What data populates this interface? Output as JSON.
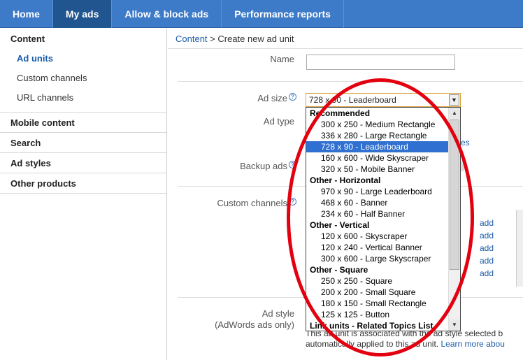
{
  "topnav": {
    "tabs": [
      {
        "label": "Home"
      },
      {
        "label": "My ads"
      },
      {
        "label": "Allow & block ads"
      },
      {
        "label": "Performance reports"
      }
    ]
  },
  "sidebar": {
    "content": "Content",
    "ad_units": "Ad units",
    "custom_channels": "Custom channels",
    "url_channels": "URL channels",
    "mobile_content": "Mobile content",
    "search": "Search",
    "ad_styles": "Ad styles",
    "other_products": "Other products"
  },
  "breadcrumb": {
    "root": "Content",
    "sep": " > ",
    "current": "Create new ad unit"
  },
  "form": {
    "name_label": "Name",
    "name_value": "",
    "ad_size_label": "Ad size",
    "ad_size_value": "728 x 90 - Leaderboard",
    "ad_type_label": "Ad type",
    "backup_ads_label": "Backup ads",
    "custom_channels_label": "Custom channels",
    "ad_style_label": "Ad style",
    "ad_style_sub": "(AdWords ads only)",
    "partial_link": "es",
    "add_links": [
      "add",
      "add",
      "add",
      "add",
      "add"
    ],
    "bottom_line1": "This ad unit is associated with the ad style selected b",
    "bottom_line2": "automatically applied to this ad unit.",
    "learn_more": "Learn more abou"
  },
  "dropdown": {
    "items": [
      {
        "type": "group",
        "label": "Recommended"
      },
      {
        "type": "opt",
        "label": "300 x 250 - Medium Rectangle"
      },
      {
        "type": "opt",
        "label": "336 x 280 - Large Rectangle"
      },
      {
        "type": "opt",
        "label": "728 x 90 - Leaderboard",
        "selected": true
      },
      {
        "type": "opt",
        "label": "160 x 600 - Wide Skyscraper"
      },
      {
        "type": "opt",
        "label": "320 x 50 - Mobile Banner"
      },
      {
        "type": "group",
        "label": "Other - Horizontal"
      },
      {
        "type": "opt",
        "label": "970 x 90 - Large Leaderboard"
      },
      {
        "type": "opt",
        "label": "468 x 60 - Banner"
      },
      {
        "type": "opt",
        "label": "234 x 60 - Half Banner"
      },
      {
        "type": "group",
        "label": "Other - Vertical"
      },
      {
        "type": "opt",
        "label": "120 x 600 - Skyscraper"
      },
      {
        "type": "opt",
        "label": "120 x 240 - Vertical Banner"
      },
      {
        "type": "opt",
        "label": "300 x 600 - Large Skyscraper"
      },
      {
        "type": "group",
        "label": "Other - Square"
      },
      {
        "type": "opt",
        "label": "250 x 250 - Square"
      },
      {
        "type": "opt",
        "label": "200 x 200 - Small Square"
      },
      {
        "type": "opt",
        "label": "180 x 150 - Small Rectangle"
      },
      {
        "type": "opt",
        "label": "125 x 125 - Button"
      },
      {
        "type": "group",
        "label": "Link units - Related Topics List"
      }
    ]
  },
  "colors": {
    "nav_bg": "#3d7ac7",
    "nav_active": "#20558f",
    "link": "#1b5ba7",
    "highlight": "#e3000f",
    "selected": "#3070d0"
  }
}
